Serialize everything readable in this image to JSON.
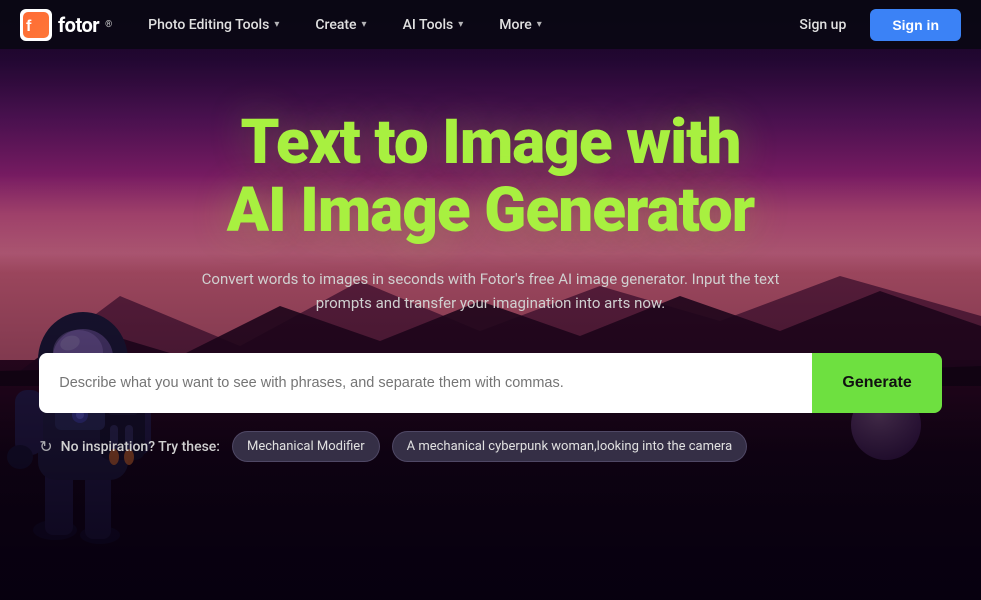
{
  "nav": {
    "logo_text": "fotor",
    "logo_sup": "®",
    "items": [
      {
        "label": "Photo Editing Tools",
        "has_chevron": true
      },
      {
        "label": "Create",
        "has_chevron": true
      },
      {
        "label": "AI Tools",
        "has_chevron": true
      },
      {
        "label": "More",
        "has_chevron": true
      }
    ],
    "signup_label": "Sign up",
    "signin_label": "Sign in"
  },
  "hero": {
    "title_line1": "Text to Image with",
    "title_line2": "AI Image Generator",
    "subtitle": "Convert words to images in seconds with Fotor's free AI image generator. Input the text prompts and transfer your imagination into arts now."
  },
  "search": {
    "placeholder": "Describe what you want to see with phrases, and separate them with commas.",
    "generate_label": "Generate"
  },
  "inspiration": {
    "label": "No inspiration? Try these:",
    "tags": [
      {
        "label": "Mechanical Modifier"
      },
      {
        "label": "A mechanical cyberpunk woman,looking into the camera"
      }
    ]
  }
}
